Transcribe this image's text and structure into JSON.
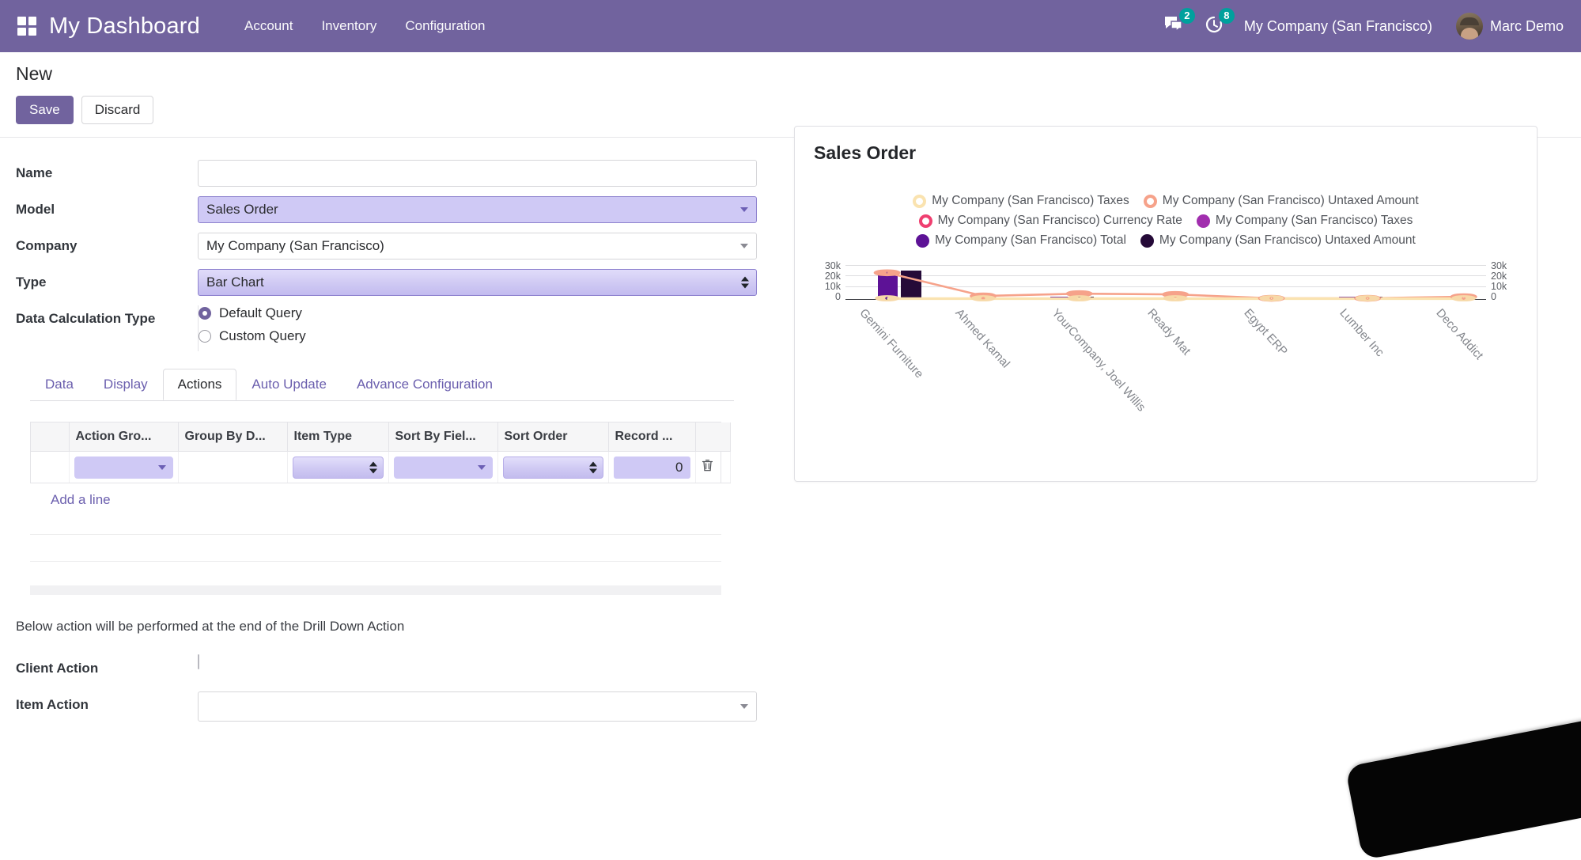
{
  "topbar": {
    "apps_icon": "apps-grid-icon",
    "brand": "My Dashboard",
    "menu": [
      {
        "label": "Account"
      },
      {
        "label": "Inventory"
      },
      {
        "label": "Configuration"
      }
    ],
    "messages_icon": "chat-bubble-icon",
    "messages_count": "2",
    "activities_icon": "clock-icon",
    "activities_count": "8",
    "company": "My Company (San Francisco)",
    "user": "Marc Demo",
    "avatar": "user-avatar",
    "accent": "#71639e"
  },
  "breadcrumb": {
    "title": "New"
  },
  "actions": {
    "save": "Save",
    "discard": "Discard"
  },
  "form": {
    "name": {
      "label": "Name",
      "value": "",
      "placeholder": ""
    },
    "model": {
      "label": "Model",
      "value": "Sales Order"
    },
    "company": {
      "label": "Company",
      "value": "My Company (San Francisco)"
    },
    "type": {
      "label": "Type",
      "value": "Bar Chart"
    },
    "data_calculation_type": {
      "label": "Data Calculation Type",
      "options": [
        {
          "label": "Default Query",
          "selected": true
        },
        {
          "label": "Custom Query",
          "selected": false
        }
      ]
    }
  },
  "tabs": [
    {
      "label": "Data",
      "active": false
    },
    {
      "label": "Display",
      "active": false
    },
    {
      "label": "Actions",
      "active": true
    },
    {
      "label": "Auto Update",
      "active": false
    },
    {
      "label": "Advance Configuration",
      "active": false
    }
  ],
  "action_table": {
    "columns": [
      "Action Gro...",
      "Group By D...",
      "Item Type",
      "Sort By Fiel...",
      "Sort Order",
      "Record ..."
    ],
    "rows": [
      {
        "action_group": "",
        "group_by_date": "",
        "item_type": "",
        "sort_by_field": "",
        "sort_order": "",
        "record_limit": "0",
        "delete_icon": "trash-icon"
      }
    ],
    "add_line": "Add a line"
  },
  "bottom": {
    "note": "Below action will be performed at the end of the Drill Down Action",
    "client_action": {
      "label": "Client Action",
      "checked": false
    },
    "item_action": {
      "label": "Item Action",
      "value": ""
    }
  },
  "chart_card": {
    "title": "Sales Order"
  },
  "chart_data": {
    "type": "bar",
    "title": "Sales Order",
    "xlabel": "",
    "ylabel": "",
    "ylim": [
      0,
      30000
    ],
    "yticks": [
      0,
      10000,
      20000,
      30000
    ],
    "ytick_labels": [
      "0",
      "10k",
      "20k",
      "30k"
    ],
    "grid": true,
    "legend_position": "top-center",
    "dual_axis": true,
    "categories": [
      "Gemini Furniture",
      "Ahmed Kamal",
      "YourCompany, Joel Willis",
      "Ready Mat",
      "Egypt ERP",
      "Lumber Inc",
      "Deco Addict"
    ],
    "series": [
      {
        "name": "My Company (San Francisco) Taxes",
        "kind": "line",
        "marker": "ring",
        "color": "#fae3b0",
        "values": [
          0,
          0,
          0,
          0,
          0,
          0,
          0
        ]
      },
      {
        "name": "My Company (San Francisco) Untaxed Amount",
        "kind": "line",
        "marker": "ring",
        "color": "#f6a28a",
        "values": [
          23000,
          2200,
          4600,
          3900,
          500,
          500,
          2000
        ]
      },
      {
        "name": "My Company (San Francisco) Currency Rate",
        "kind": "line",
        "marker": "ring",
        "color": "#ef3f70",
        "values": [
          0,
          0,
          0,
          0,
          0,
          0,
          0
        ]
      },
      {
        "name": "My Company (San Francisco) Taxes",
        "kind": "bar",
        "marker": "dot",
        "color": "#a12eae",
        "values": [
          0,
          0,
          0,
          0,
          0,
          0,
          0
        ]
      },
      {
        "name": "My Company (San Francisco) Total",
        "kind": "bar",
        "marker": "dot",
        "color": "#5d1296",
        "values": [
          23500,
          0,
          1700,
          0,
          0,
          0,
          1500
        ]
      },
      {
        "name": "My Company (San Francisco) Untaxed Amount",
        "kind": "bar",
        "marker": "dot",
        "color": "#250a38",
        "values": [
          23800,
          0,
          1800,
          0,
          0,
          0,
          1700
        ]
      }
    ]
  }
}
